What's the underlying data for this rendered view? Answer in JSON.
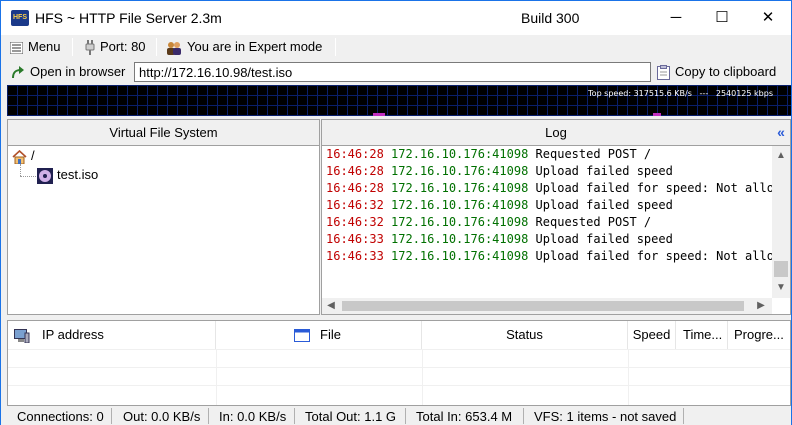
{
  "window": {
    "title": "HFS ~ HTTP File Server 2.3m",
    "build": "Build 300",
    "controls": {
      "minimize": "─",
      "maximize": "☐",
      "close": "✕"
    }
  },
  "toolbar": {
    "menu_label": "Menu",
    "port_label": "Port: 80",
    "mode_label": "You are in Expert mode"
  },
  "url_bar": {
    "open_browser_label": "Open in browser",
    "url_value": "http://172.16.10.98/test.iso",
    "copy_label": "Copy to clipboard"
  },
  "graph": {
    "top_speed_text": "Top speed: 317515.6 KB/s",
    "separator": "---",
    "kbps_text": "2540125 kbps"
  },
  "vfs": {
    "header": "Virtual File System",
    "root_label": "/",
    "items": [
      {
        "name": "test.iso"
      }
    ]
  },
  "log": {
    "header": "Log",
    "collapse_icon": "«",
    "lines": [
      {
        "time": "16:46:28",
        "addr": "172.16.10.176:41098",
        "msg": "Requested POST /"
      },
      {
        "time": "16:46:28",
        "addr": "172.16.10.176:41098",
        "msg": "Upload failed speed"
      },
      {
        "time": "16:46:28",
        "addr": "172.16.10.176:41098",
        "msg": "Upload failed for speed: Not allowed"
      },
      {
        "time": "16:46:32",
        "addr": "172.16.10.176:41098",
        "msg": "Upload failed speed"
      },
      {
        "time": "16:46:32",
        "addr": "172.16.10.176:41098",
        "msg": "Requested POST /"
      },
      {
        "time": "16:46:33",
        "addr": "172.16.10.176:41098",
        "msg": "Upload failed speed"
      },
      {
        "time": "16:46:33",
        "addr": "172.16.10.176:41098",
        "msg": "Upload failed for speed: Not allowed"
      }
    ]
  },
  "connections": {
    "columns": {
      "ip": "IP address",
      "file": "File",
      "status": "Status",
      "speed": "Speed",
      "time": "Time...",
      "progress": "Progre..."
    }
  },
  "statusbar": {
    "connections": "Connections: 0",
    "out": "Out: 0.0 KB/s",
    "in": "In: 0.0 KB/s",
    "total_out": "Total Out: 1.1 G",
    "total_in": "Total In: 653.4 M",
    "vfs": "VFS: 1 items - not saved"
  }
}
